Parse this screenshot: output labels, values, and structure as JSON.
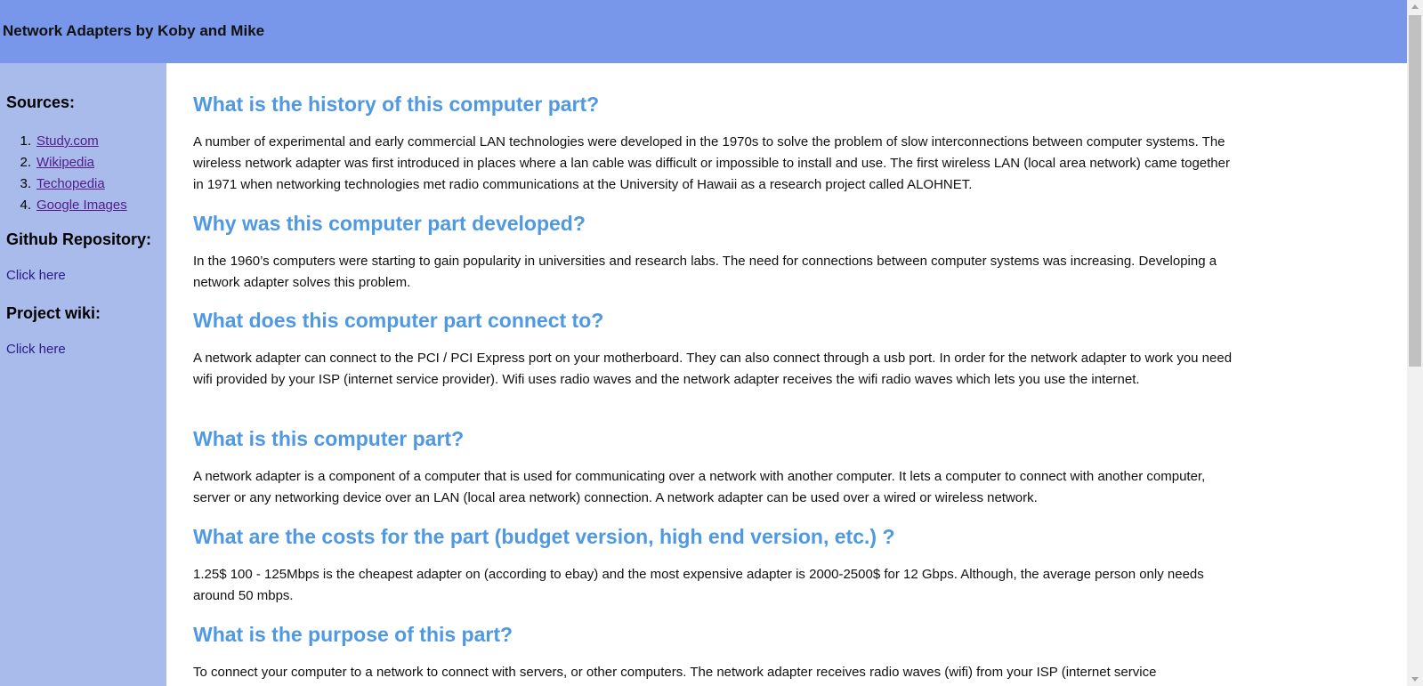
{
  "header": {
    "title": "Network Adapters by Koby and Mike"
  },
  "sidebar": {
    "sources_heading": "Sources:",
    "sources": [
      {
        "num": "1.",
        "label": "Study.com"
      },
      {
        "num": "2.",
        "label": "Wikipedia"
      },
      {
        "num": "3.",
        "label": "Techopedia"
      },
      {
        "num": "4.",
        "label": "Google Images"
      }
    ],
    "github_heading": "Github Repository:",
    "github_link": "Click here",
    "wiki_heading": "Project wiki:",
    "wiki_link": "Click here"
  },
  "main": {
    "sections": [
      {
        "heading": "What is the history of this computer part?",
        "body": "A number of experimental and early commercial LAN technologies were developed in the 1970s to solve the problem of slow interconnections between computer systems. The wireless network adapter was first introduced in places where a lan cable was difficult or impossible to install and use. The first wireless LAN (local area network) came together in 1971 when networking technologies met radio communications at the University of Hawaii as a research project called ALOHNET."
      },
      {
        "heading": "Why was this computer part developed?",
        "body": "In the 1960’s computers were starting to gain popularity in universities and research labs. The need for connections between computer systems was increasing. Developing a network adapter solves this problem."
      },
      {
        "heading": "What does this computer part connect to?",
        "body": "A network adapter can connect to the PCI / PCI Express port on your motherboard. They can also connect through a usb port. In order for the network adapter to work you need wifi provided by your ISP (internet service provider). Wifi uses radio waves and the network adapter receives the wifi radio waves which lets you use the internet."
      },
      {
        "heading": "What is this computer part?",
        "body": "A network adapter is a component of a computer that is used for communicating over a network with another computer. It lets a computer to connect with another computer, server or any networking device over an LAN (local area network) connection. A network adapter can be used over a wired or wireless network."
      },
      {
        "heading": "What are the costs for the part (budget version, high end version, etc.) ?",
        "body": "1.25$ 100 - 125Mbps is the cheapest adapter on (according to ebay) and the most expensive adapter is 2000-2500$ for 12 Gbps. Although, the average person only needs around 50 mbps."
      },
      {
        "heading": "What is the purpose of this part?",
        "body": "To connect your computer to a network to connect with servers, or other computers. The network adapter receives radio waves (wifi) from your ISP (internet service"
      }
    ]
  }
}
